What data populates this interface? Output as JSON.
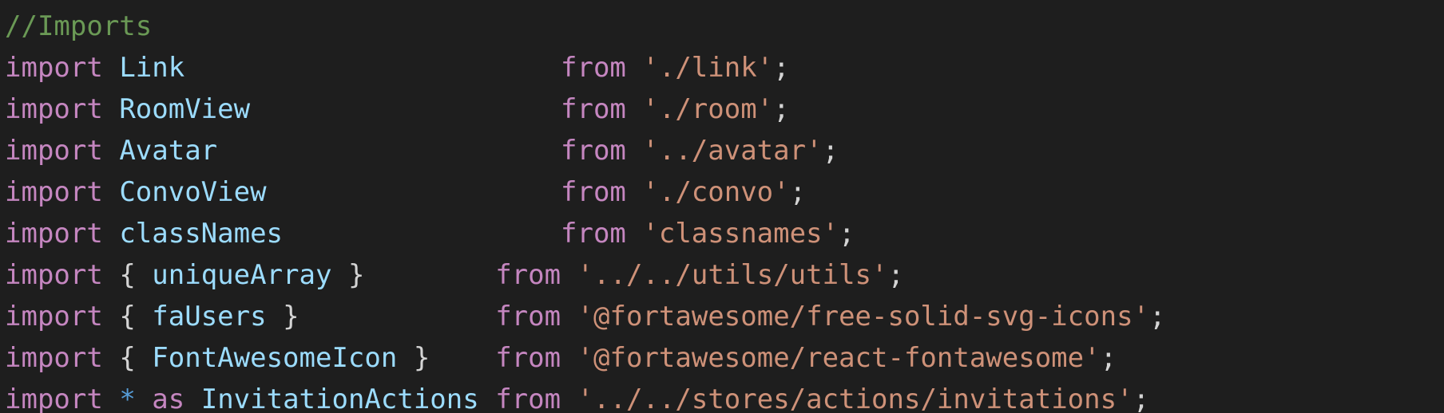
{
  "colors": {
    "background": "#1e1e1e",
    "comment": "#6a9955",
    "keyword": "#c586c0",
    "identifier": "#9cdcfe",
    "string": "#ce9178",
    "punctuation": "#d4d4d4",
    "operator": "#569cd6"
  },
  "code": {
    "comment": "//Imports",
    "kw_import": "import",
    "kw_from": "from",
    "kw_as": "as",
    "star": "*",
    "brace_open": "{",
    "brace_close": "}",
    "semicolon": ";",
    "lines": [
      {
        "ident": "Link",
        "path": "'./link'"
      },
      {
        "ident": "RoomView",
        "path": "'./room'"
      },
      {
        "ident": "Avatar",
        "path": "'../avatar'"
      },
      {
        "ident": "ConvoView",
        "path": "'./convo'"
      },
      {
        "ident": "classNames",
        "path": "'classnames'"
      },
      {
        "ident": "uniqueArray",
        "path": "'../../utils/utils'"
      },
      {
        "ident": "faUsers",
        "path": "'@fortawesome/free-solid-svg-icons'"
      },
      {
        "ident": "FontAwesomeIcon",
        "path": "'@fortawesome/react-fontawesome'"
      },
      {
        "ident": "InvitationActions",
        "path": "'../../stores/actions/invitations'"
      }
    ]
  }
}
